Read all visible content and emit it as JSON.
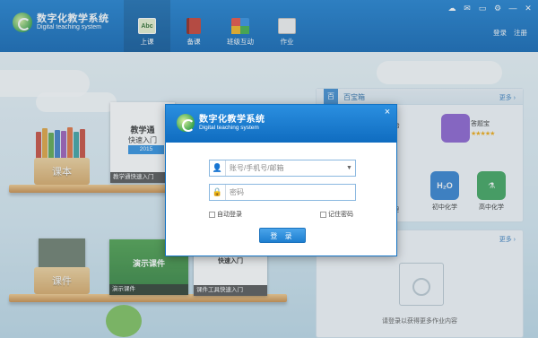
{
  "app": {
    "title_cn": "数字化教学系统",
    "title_en": "Digital teaching system"
  },
  "nav": [
    {
      "label": "上课",
      "icon": "abc-board-icon",
      "active": true,
      "icon_text": "Abc"
    },
    {
      "label": "备课",
      "icon": "red-book-icon",
      "active": false,
      "icon_text": ""
    },
    {
      "label": "班级互动",
      "icon": "windows-tiles-icon",
      "active": false,
      "icon_text": ""
    },
    {
      "label": "作业",
      "icon": "pen-paper-icon",
      "active": false,
      "icon_text": ""
    }
  ],
  "auth": {
    "login": "登录",
    "register": "注册"
  },
  "window_controls": {
    "cloud": "☁",
    "mail": "✉",
    "chat": "▭",
    "settings": "⚙",
    "minimize": "—",
    "close": "✕"
  },
  "shelves": {
    "textbook_label": "课本",
    "courseware_label": "课件",
    "cards": [
      {
        "title_line1": "教学通",
        "title_line2": "快速入门",
        "badge": "2015",
        "caption": "教学通快速入门"
      },
      {
        "title_line1": "演示课件",
        "caption": "演示课件"
      },
      {
        "title_line1": "快速入门",
        "caption": "课件工具快速入门"
      }
    ]
  },
  "panel_top": {
    "badge": "百",
    "title": "百宝箱",
    "more": "更多 ›",
    "apps": [
      {
        "name": "台",
        "partial": true
      },
      {
        "name": "答题宝",
        "stars": "★★★★★"
      },
      {
        "name": "地理",
        "partial": true
      },
      {
        "name": "初中化学",
        "icon_text": "H₂O"
      },
      {
        "name": "高中化学",
        "icon_text": "⚗"
      }
    ]
  },
  "panel_bottom": {
    "more": "更多 ›",
    "message": "请登录以获得更多作业内容"
  },
  "login_dialog": {
    "title_cn": "数字化教学系统",
    "title_en": "Digital teaching system",
    "close": "×",
    "account_placeholder": "账号/手机号/邮箱",
    "password_placeholder": "密码",
    "auto_login": "自动登录",
    "remember_password": "记住密码",
    "submit": "登 录"
  },
  "colors": {
    "brand": "#0a6fc4",
    "accent": "#2b8fe0"
  }
}
